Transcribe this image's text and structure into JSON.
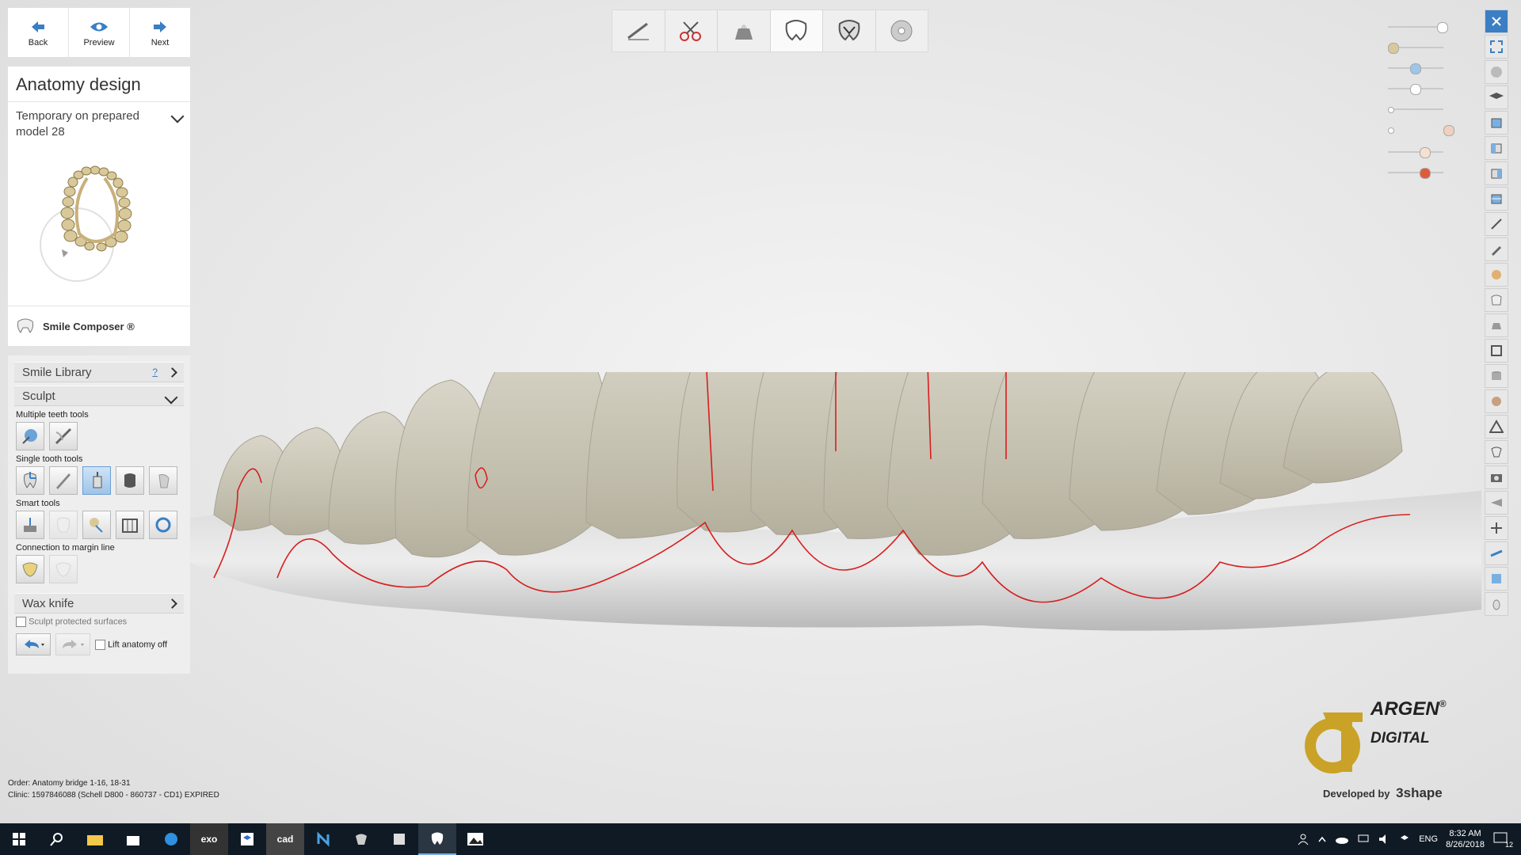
{
  "nav": {
    "back": "Back",
    "preview": "Preview",
    "next": "Next"
  },
  "panel": {
    "title": "Anatomy design",
    "subtitle": "Temporary on prepared model 28",
    "smile_composer": "Smile Composer ®"
  },
  "tools": {
    "smile_library": "Smile Library",
    "help": "?",
    "sculpt": "Sculpt",
    "multiple_teeth_tools": "Multiple teeth tools",
    "single_tooth_tools": "Single tooth tools",
    "smart_tools": "Smart tools",
    "connection_to_margin_line": "Connection to margin line",
    "wax_knife": "Wax knife",
    "sculpt_protected_surfaces": "Sculpt protected surfaces",
    "lift_anatomy_off": "Lift anatomy off"
  },
  "footer": {
    "order_label": "Order:",
    "order_value": "Anatomy bridge 1-16, 18-31",
    "clinic_label": "Clinic:",
    "clinic_value": "1597846088 (Schell D800 - 860737 - CD1) EXPIRED"
  },
  "brand": {
    "argen": "ARGEN",
    "reg": "®",
    "digital": "DIGITAL",
    "developed_by": "Developed by",
    "company": "3shape"
  },
  "taskbar": {
    "apps": [
      "exo",
      "cad"
    ],
    "lang": "ENG",
    "time": "8:32 AM",
    "date": "8/26/2018",
    "notifications": "12"
  },
  "colors": {
    "accent": "#3a7fc4",
    "margin_line": "#d81e1e",
    "gold": "#c9a227"
  }
}
